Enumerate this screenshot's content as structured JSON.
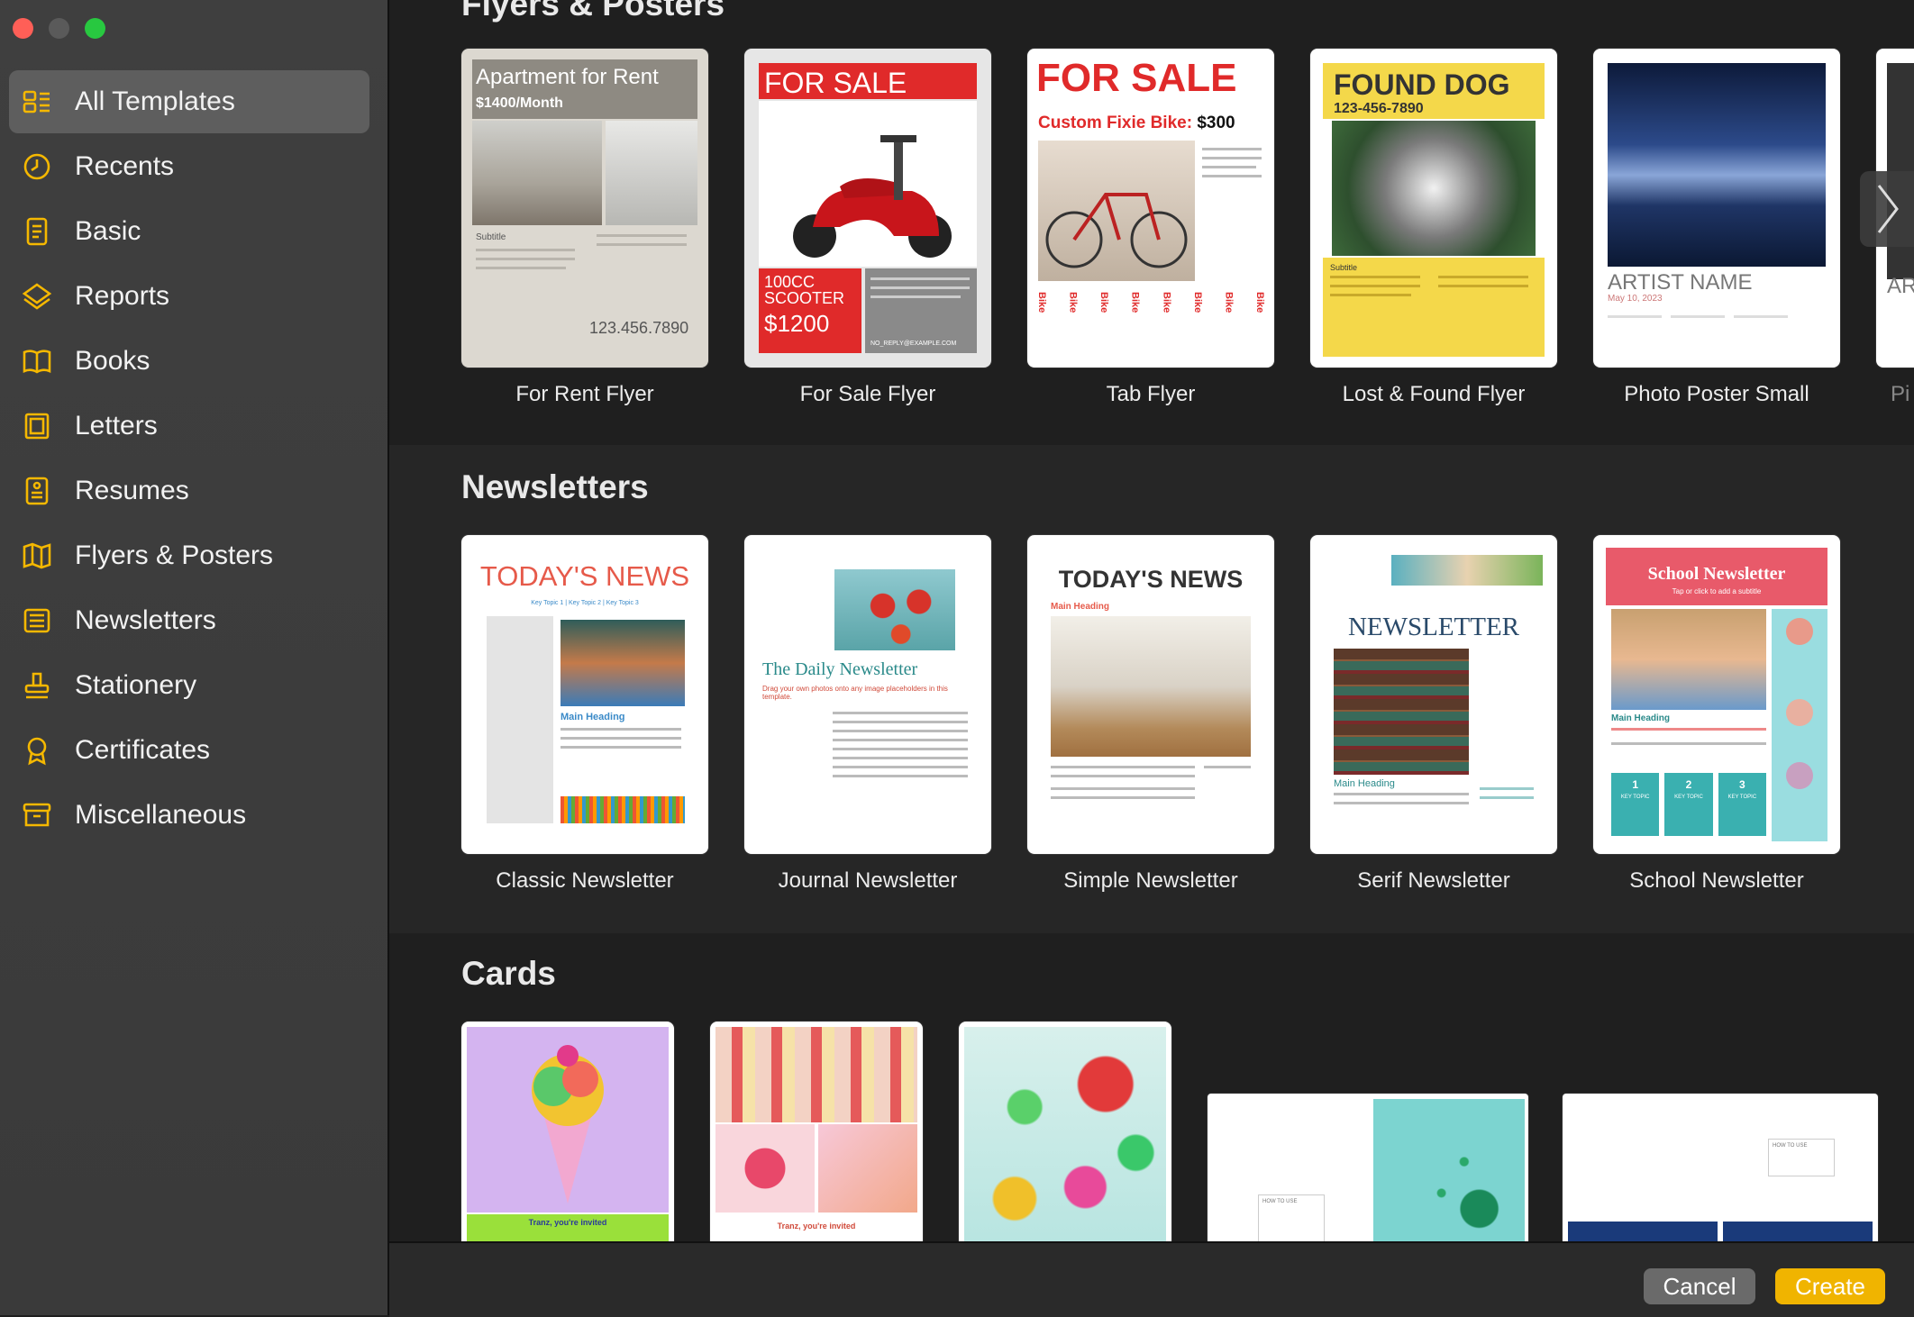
{
  "sidebar": {
    "items": [
      {
        "label": "All Templates",
        "icon": "grid-icon",
        "active": true
      },
      {
        "label": "Recents",
        "icon": "clock-icon"
      },
      {
        "label": "Basic",
        "icon": "document-icon"
      },
      {
        "label": "Reports",
        "icon": "report-icon"
      },
      {
        "label": "Books",
        "icon": "book-icon"
      },
      {
        "label": "Letters",
        "icon": "letter-icon"
      },
      {
        "label": "Resumes",
        "icon": "resume-icon"
      },
      {
        "label": "Flyers & Posters",
        "icon": "map-icon"
      },
      {
        "label": "Newsletters",
        "icon": "newsletter-icon"
      },
      {
        "label": "Stationery",
        "icon": "stamp-icon"
      },
      {
        "label": "Certificates",
        "icon": "ribbon-icon"
      },
      {
        "label": "Miscellaneous",
        "icon": "archive-icon"
      }
    ]
  },
  "sections": {
    "flyers": {
      "title": "Flyers & Posters",
      "templates": [
        {
          "label": "For Rent Flyer",
          "heading": "Apartment for Rent",
          "sub": "$1400/Month",
          "phone": "123.456.7890",
          "subtitle": "Subtitle"
        },
        {
          "label": "For Sale Flyer",
          "heading": "FOR SALE",
          "line1": "100CC",
          "line2": "SCOOTER",
          "price": "$1200",
          "email": "NO_REPLY@EXAMPLE.COM"
        },
        {
          "label": "Tab Flyer",
          "heading": "FOR SALE",
          "sub": "Custom Fixie Bike:",
          "price": "$300",
          "tab": "Bike"
        },
        {
          "label": "Lost & Found Flyer",
          "heading": "FOUND DOG",
          "sub": "123-456-7890",
          "subtitle": "Subtitle"
        },
        {
          "label": "Photo Poster Small",
          "heading": "ARTIST NAME",
          "date": "May 10, 2023"
        },
        {
          "label": "Pi",
          "partial": "AR"
        }
      ]
    },
    "newsletters": {
      "title": "Newsletters",
      "templates": [
        {
          "label": "Classic Newsletter",
          "heading": "TODAY'S NEWS",
          "topics": "Key Topic 1 | Key Topic 2 | Key Topic 3",
          "sub": "Main Heading"
        },
        {
          "label": "Journal Newsletter",
          "heading": "The Daily Newsletter",
          "sub": "Drag your own photos onto any image placeholders in this template."
        },
        {
          "label": "Simple Newsletter",
          "heading": "TODAY'S NEWS",
          "sub": "Main Heading"
        },
        {
          "label": "Serif Newsletter",
          "heading": "NEWSLETTER",
          "sub": "Main Heading"
        },
        {
          "label": "School Newsletter",
          "heading": "School Newsletter",
          "sub": "Tap or click to add a subtitle",
          "main": "Main Heading",
          "numbers": [
            "1",
            "2",
            "3"
          ],
          "topic": "KEY TOPIC"
        }
      ]
    },
    "cards": {
      "title": "Cards",
      "templates": [
        {
          "caption": "Tranz, you're invited"
        },
        {
          "caption": "Tranz, you're invited"
        },
        {},
        {
          "caption": "HOW TO USE"
        },
        {
          "caption": "HOW TO USE"
        }
      ]
    }
  },
  "footer": {
    "cancel": "Cancel",
    "create": "Create"
  },
  "colors": {
    "accent": "#f0b400",
    "sidebar": "#3c3c3c",
    "selected": "#5e5e5e"
  }
}
